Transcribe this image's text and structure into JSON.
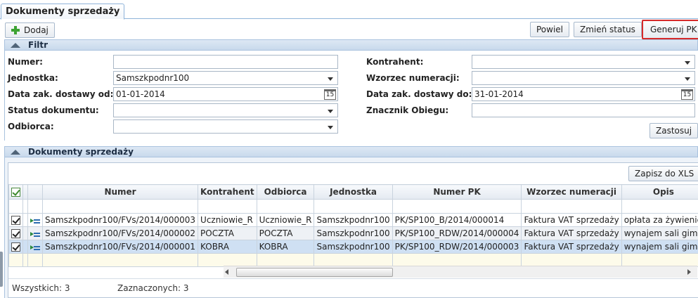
{
  "tab": {
    "title": "Dokumenty sprzedaży"
  },
  "toolbar": {
    "add_label": "Dodaj",
    "duplicate_label": "Powiel",
    "change_status_label": "Zmień status",
    "generate_label": "Generuj PK"
  },
  "filter": {
    "section_title": "Filtr",
    "numer_label": "Numer:",
    "numer_value": "",
    "jednostka_label": "Jednostka:",
    "jednostka_value": "Samszkpodnr100",
    "data_od_label": "Data zak. dostawy od:",
    "data_od_value": "01-01-2014",
    "status_label": "Status dokumentu:",
    "status_value": "",
    "odbiorca_label": "Odbiorca:",
    "odbiorca_value": "",
    "kontrahent_label": "Kontrahent:",
    "kontrahent_value": "",
    "wzorzec_label": "Wzorzec numeracji:",
    "wzorzec_value": "",
    "data_do_label": "Data zak. dostawy do:",
    "data_do_value": "31-01-2014",
    "znacznik_label": "Znacznik Obiegu:",
    "znacznik_value": "",
    "calendar_glyph": "15",
    "apply_label": "Zastosuj"
  },
  "documents": {
    "section_title": "Dokumenty sprzedaży",
    "export_label": "Zapisz do XLS",
    "columns": [
      "Numer",
      "Kontrahent",
      "Odbiorca",
      "Jednostka",
      "Numer PK",
      "Wzorzec numeracji",
      "Opis"
    ],
    "rows": [
      {
        "numer": "Samszkpodnr100/FVs/2014/000003",
        "kontrahent": "Uczniowie_R",
        "odbiorca": "Uczniowie_R",
        "jednostka": "Samszkpodnr100",
        "numer_pk": "PK/SP100_B/2014/000014",
        "wzorzec": "Faktura VAT sprzedaży",
        "opis": "opłata za żywienie"
      },
      {
        "numer": "Samszkpodnr100/FVs/2014/000002",
        "kontrahent": "POCZTA",
        "odbiorca": "POCZTA",
        "jednostka": "Samszkpodnr100",
        "numer_pk": "PK/SP100_RDW/2014/000004",
        "wzorzec": "Faktura VAT sprzedaży",
        "opis": "wynajem sali gimn"
      },
      {
        "numer": "Samszkpodnr100/FVs/2014/000001",
        "kontrahent": "KOBRA",
        "odbiorca": "KOBRA",
        "jednostka": "Samszkpodnr100",
        "numer_pk": "PK/SP100_RDW/2014/000003",
        "wzorzec": "Faktura VAT sprzedaży",
        "opis": "wynajem sali gimn"
      }
    ],
    "total_label": "Wszystkich: 3",
    "selected_label": "Zaznaczonych: 3"
  },
  "icons": [
    "plus-icon",
    "collapse-up-icon",
    "dropdown-arrow-icon",
    "calendar-icon",
    "checkbox-icon",
    "document-action-icon",
    "scroll-left-icon",
    "scroll-right-icon"
  ]
}
